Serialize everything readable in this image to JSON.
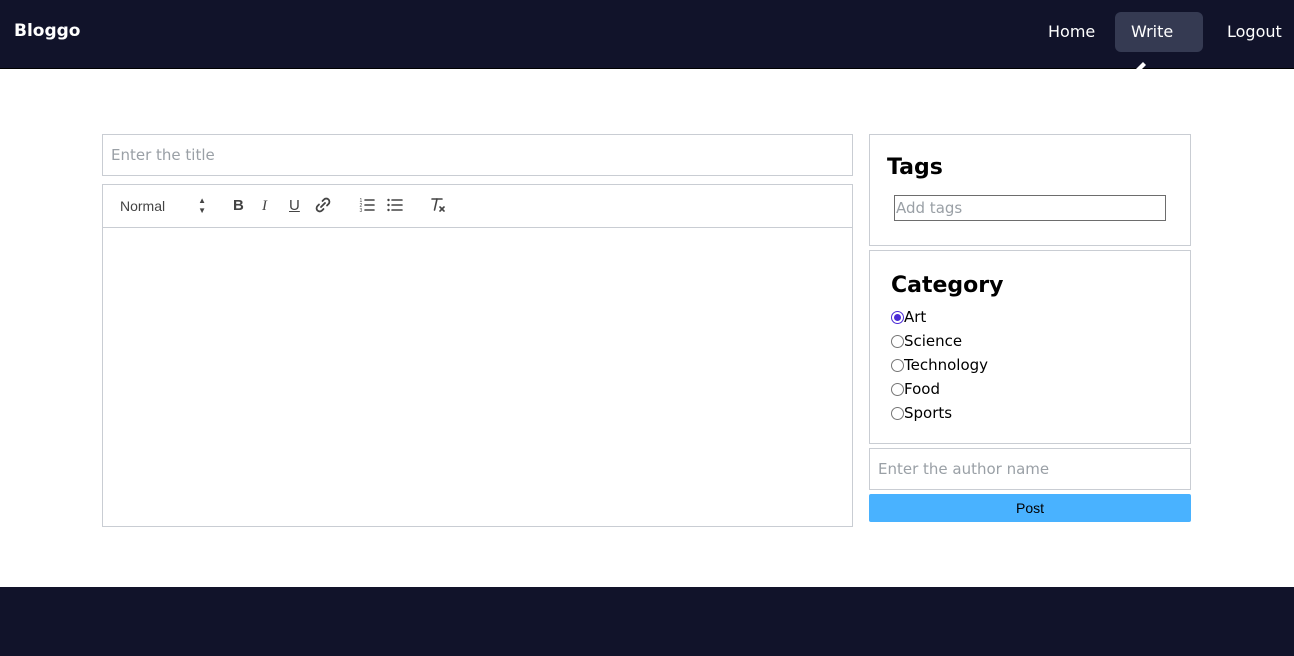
{
  "navbar": {
    "brand": "Bloggo",
    "links": [
      {
        "label": "Home"
      },
      {
        "label": "Write"
      },
      {
        "label": "Logout"
      }
    ]
  },
  "editor": {
    "title_placeholder": "Enter the title",
    "toolbar": {
      "format_select": "Normal",
      "bold": "B",
      "italic": "I",
      "underline": "U",
      "icons": [
        "link-icon",
        "ordered-list-icon",
        "bullet-list-icon",
        "clear-format-icon"
      ]
    }
  },
  "tags": {
    "title": "Tags",
    "placeholder": "Add tags"
  },
  "category": {
    "title": "Category",
    "options": [
      {
        "label": "Art",
        "checked": true
      },
      {
        "label": "Science",
        "checked": false
      },
      {
        "label": "Technology",
        "checked": false
      },
      {
        "label": "Food",
        "checked": false
      },
      {
        "label": "Sports",
        "checked": false
      }
    ]
  },
  "author": {
    "placeholder": "Enter the author name"
  },
  "post_button": "Post",
  "colors": {
    "navbar": "#11132a",
    "active_nav": "#353a52",
    "post_button": "#49b2ff",
    "radio_accent": "#4b2bd6"
  }
}
